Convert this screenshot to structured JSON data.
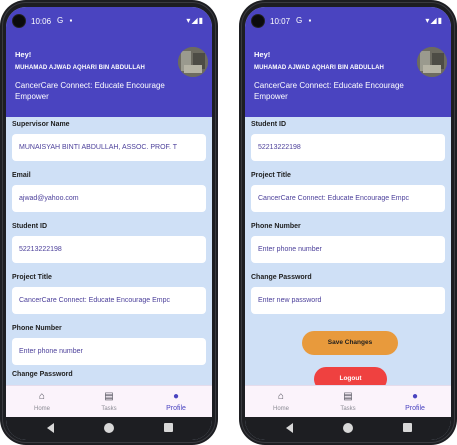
{
  "phones": [
    {
      "status": {
        "time": "10:06",
        "left_icons": "G ▪",
        "right_icons": "▾◢▮"
      },
      "header": {
        "greeting": "Hey!",
        "user_name": "MUHAMAD AJWAD AQHARI BIN ABDULLAH",
        "tagline": "CancerCare Connect: Educate Encourage Empower"
      },
      "fields": [
        {
          "label": "Supervisor Name",
          "value": "MUNAISYAH BINTI ABDULLAH, ASSOC. PROF. T"
        },
        {
          "label": "Email",
          "value": "ajwad@yahoo.com"
        },
        {
          "label": "Student ID",
          "value": "52213222198"
        },
        {
          "label": "Project Title",
          "value": "CancerCare Connect: Educate Encourage Empc"
        },
        {
          "label": "Phone Number",
          "value": "Enter phone number"
        },
        {
          "label": "Change Password",
          "value": ""
        }
      ]
    },
    {
      "status": {
        "time": "10:07",
        "left_icons": "G ▪",
        "right_icons": "▾◢▮"
      },
      "header": {
        "greeting": "Hey!",
        "user_name": "MUHAMAD AJWAD AQHARI BIN ABDULLAH",
        "tagline": "CancerCare Connect: Educate Encourage Empower"
      },
      "fields": [
        {
          "label": "Student ID",
          "value": "52213222198"
        },
        {
          "label": "Project Title",
          "value": "CancerCare Connect: Educate Encourage Empc"
        },
        {
          "label": "Phone Number",
          "value": "Enter phone number"
        },
        {
          "label": "Change Password",
          "value": "Enter new password"
        }
      ],
      "buttons": {
        "save": "Save Changes",
        "logout": "Logout"
      }
    }
  ],
  "nav": {
    "home": "Home",
    "tasks": "Tasks",
    "profile": "Profile"
  },
  "colors": {
    "primary": "#4a44c0",
    "save": "#e89a3c",
    "logout": "#ef4140",
    "background": "#cfe0f6"
  }
}
